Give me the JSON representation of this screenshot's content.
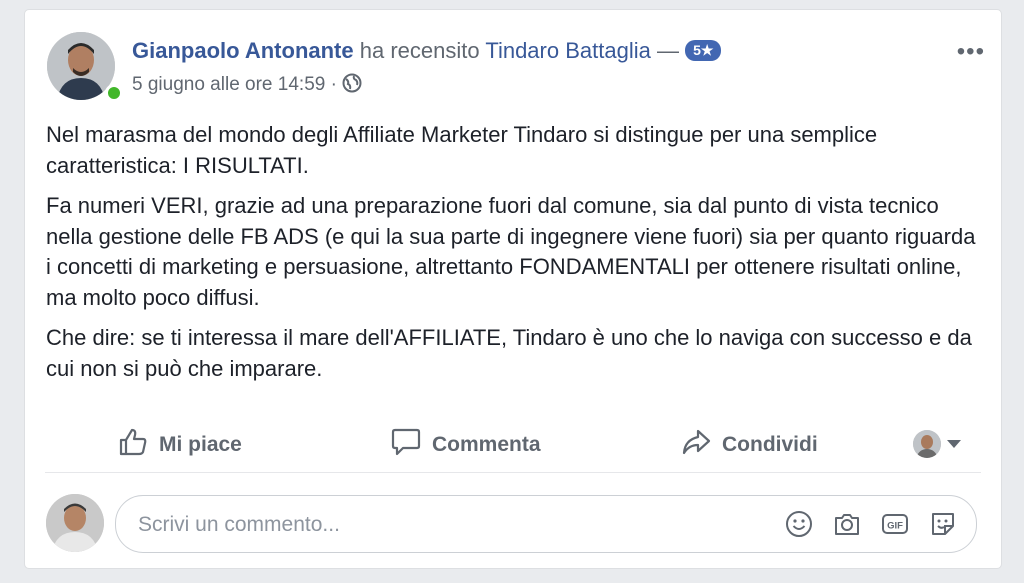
{
  "post": {
    "author": "Gianpaolo Antonante",
    "review_phrase": "ha recensito",
    "reviewed_page": "Tindaro Battaglia",
    "dash": "—",
    "rating_badge": "5★",
    "timestamp": "5 giugno alle ore 14:59",
    "separator": "·",
    "audience_icon": "globe-icon",
    "more_label": "•••",
    "paragraphs": [
      "Nel marasma del mondo degli Affiliate Marketer Tindaro si distingue per una semplice caratteristica: I RISULTATI.",
      "Fa numeri VERI, grazie ad una preparazione fuori dal comune, sia dal punto di vista tecnico nella gestione delle FB ADS (e qui la sua parte di ingegnere viene fuori) sia per quanto riguarda i concetti di marketing e persuasione, altrettanto FONDAMENTALI per ottenere risultati online, ma molto poco diffusi.",
      "Che dire: se ti interessa il mare dell'AFFILIATE, Tindaro è uno che lo naviga con successo e da cui non si può che imparare."
    ]
  },
  "actions": {
    "like_label": "Mi piace",
    "comment_label": "Commenta",
    "share_label": "Condividi"
  },
  "comment": {
    "placeholder": "Scrivi un commento...",
    "icons": [
      "emoji-icon",
      "camera-icon",
      "gif-icon",
      "sticker-icon"
    ]
  },
  "colors": {
    "link": "#385898",
    "badge": "#4267b2",
    "online": "#42b72a",
    "muted": "#606770"
  }
}
